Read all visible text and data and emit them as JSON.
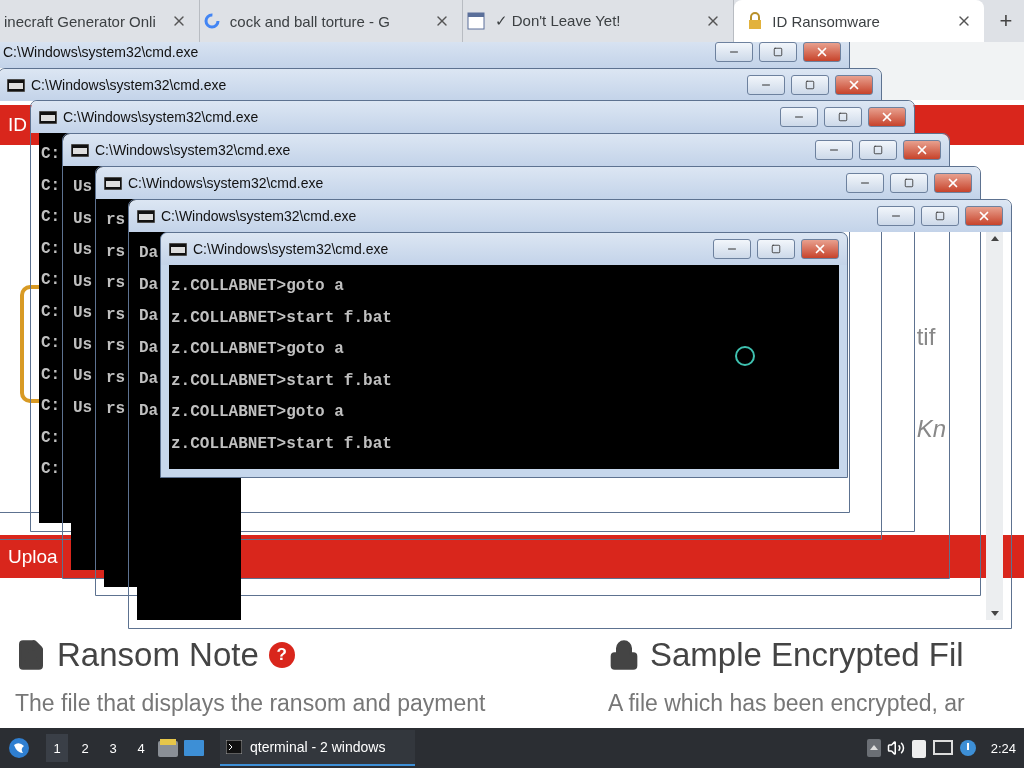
{
  "browser": {
    "tabs": [
      {
        "title": "inecraft Generator Onli",
        "kind": "plain",
        "selected": false
      },
      {
        "title": "cock and ball torture - G",
        "kind": "search",
        "selected": false
      },
      {
        "title": "✓ Don't Leave Yet!",
        "kind": "page",
        "selected": false
      },
      {
        "title": "ID Ransomware",
        "kind": "secure",
        "selected": true
      }
    ],
    "new_tab": "+"
  },
  "page": {
    "header": "ID",
    "fragments": [
      "tif",
      "Kn"
    ],
    "upload_bar": "Uploa",
    "sections": [
      {
        "heading": "Ransom Note",
        "kind": "file",
        "help": "?",
        "text": "The file that displays the ransom and payment"
      },
      {
        "heading": "Sample Encrypted Fil",
        "kind": "lock",
        "text": "A file which has been encrypted, ar"
      }
    ]
  },
  "windows": [
    {
      "title": "C:\\Windows\\system32\\cmd.exe"
    },
    {
      "title": "C:\\Windows\\system32\\cmd.exe"
    },
    {
      "title": "C:\\Windows\\system32\\cmd.exe",
      "lines": [
        "C:",
        "C:",
        "C:",
        "C:",
        "C:",
        "C:",
        "C:",
        "C:",
        "C:",
        "C:",
        "C:"
      ]
    },
    {
      "title": "C:\\Windows\\system32\\cmd.exe",
      "lines": [
        "Us",
        "Us",
        "Us",
        "Us",
        "Us",
        "Us",
        "Us",
        "Us"
      ]
    },
    {
      "title": "C:\\Windows\\system32\\cmd.exe",
      "lines": [
        "rs",
        "rs",
        "rs",
        "rs",
        "rs",
        "rs",
        "rs"
      ]
    },
    {
      "title": "C:\\Windows\\system32\\cmd.exe",
      "lines": [
        "Da",
        "Da",
        "Da",
        "Da",
        "Da",
        "Da"
      ],
      "scrollbar": true
    },
    {
      "title": "C:\\Windows\\system32\\cmd.exe",
      "lines": [
        "z.COLLABNET>goto a",
        "z.COLLABNET>start f.bat",
        "z.COLLABNET>goto a",
        "z.COLLABNET>start f.bat",
        "z.COLLABNET>goto a",
        "z.COLLABNET>start f.bat"
      ],
      "busy": true
    }
  ],
  "taskbar": {
    "workspaces": [
      {
        "label": "1",
        "selected": true
      },
      {
        "label": "2",
        "selected": false
      },
      {
        "label": "3",
        "selected": false
      },
      {
        "label": "4",
        "selected": false
      }
    ],
    "task": "qterminal - 2 windows",
    "clock": "2:24"
  }
}
